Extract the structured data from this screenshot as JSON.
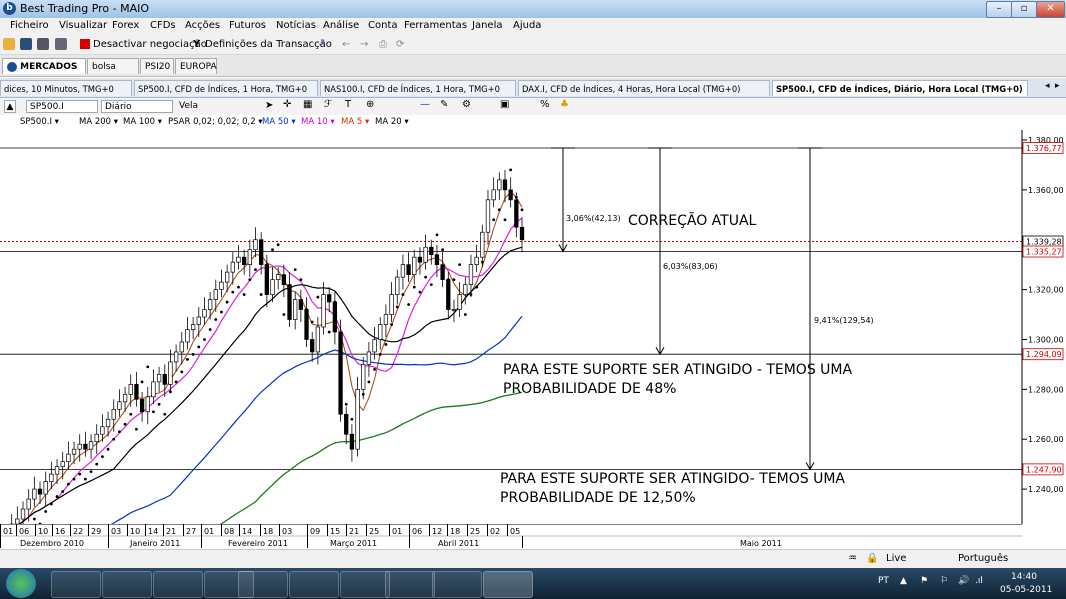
{
  "window": {
    "title": "Best Trading Pro - MAIO",
    "min": "–",
    "max": "▫",
    "close": "✕"
  },
  "menu": [
    "Ficheiro",
    "Visualizar",
    "Forex",
    "CFDs",
    "Acções",
    "Futuros",
    "Notícias",
    "Análise",
    "Conta",
    "Ferramentas",
    "Janela",
    "Ajuda"
  ],
  "toolbar": {
    "deactivate": "Desactivar negociação",
    "settings": "Definições da Transacção"
  },
  "workspace_tabs": [
    "MERCADOS",
    "bolsa usa",
    "PSI20",
    "EUROPA"
  ],
  "workspace_close": "×",
  "chart_tabs": [
    "dices, 10 Minutos, TMG+0",
    "SP500.I, CFD de Índices, 1 Hora, TMG+0",
    "NAS100.I, CFD de Índices, 1 Hora, TMG+0",
    "DAX.I, CFD de Índices, 4 Horas, Hora Local (TMG+0)",
    "SP500.I, CFD de Índices, Diário, Hora Local (TMG+0)"
  ],
  "chart_toolbar": {
    "symbol": "SP500.I",
    "period": "Diário",
    "style": "Vela"
  },
  "indicators": [
    "SP500.I ▾",
    "MA 200 ▾",
    "MA 100 ▾",
    "PSAR 0,02; 0,02; 0,2 ▾",
    "MA 50 ▾",
    "MA 10 ▾",
    "MA 5 ▾",
    "MA 20 ▾"
  ],
  "indicator_colors": [
    "#000000",
    "#000000",
    "#1a7a1a",
    "#000000",
    "#0033cc",
    "#cc00cc",
    "#cc3300",
    "#000000"
  ],
  "status": {
    "live": "Live",
    "language": "Português"
  },
  "tray": {
    "lang": "PT",
    "time": "14:40",
    "date": "05-05-2011"
  },
  "chart_data": {
    "type": "candlestick",
    "symbol": "SP500.I",
    "timeframe": "Diário",
    "ylim": [
      1226,
      1384
    ],
    "y_ticks": [
      1240,
      1260,
      1280,
      1300,
      1320,
      1340,
      1360,
      1380
    ],
    "y_tick_labels": [
      "1.240,00",
      "1.260,00",
      "1.280,00",
      "1.300,00",
      "1.320,00",
      "1.340,00",
      "1.360,00",
      "1.380,00"
    ],
    "x_day_labels": [
      "01",
      "06",
      "10",
      "16",
      "22",
      "29",
      "03",
      "10",
      "14",
      "21",
      "27",
      "01",
      "08",
      "14",
      "18",
      "03",
      "09",
      "15",
      "21",
      "25",
      "01",
      "06",
      "12",
      "18",
      "25",
      "02",
      "05"
    ],
    "x_month_labels": [
      "Dezembro 2010",
      "Janeiro 2011",
      "Fevereiro 2011",
      "Março 2011",
      "Abril 2011",
      "Maio 2011"
    ],
    "price_labels": [
      {
        "value": 1376.77,
        "label": "1.376,77",
        "color": "#cc0000"
      },
      {
        "value": 1339.28,
        "label": "1.339,28",
        "color": "#000000"
      },
      {
        "value": 1335.27,
        "label": "1.335,27",
        "color": "#cc0000"
      },
      {
        "value": 1294.09,
        "label": "1.294,09",
        "color": "#cc0000"
      },
      {
        "value": 1247.9,
        "label": "1.247,90",
        "color": "#cc0000"
      }
    ],
    "levels": [
      1376.77,
      1335.27,
      1294.09,
      1247.9
    ],
    "current_price": 1339.28,
    "measures": [
      {
        "label": "3,06%(42,13)",
        "from": 1376.77,
        "to": 1335.27
      },
      {
        "label": "6,03%(83,06)",
        "from": 1376.77,
        "to": 1294.09
      },
      {
        "label": "9,41%(129,54)",
        "from": 1376.77,
        "to": 1247.9
      }
    ],
    "annotations": [
      "CORREÇÃO ATUAL",
      "PARA ESTE SUPORTE SER ATINGIDO - TEMOS UMA",
      "PROBABILIDADE DE 48%",
      "PARA ESTE SUPORTE SER ATINGIDO- TEMOS UMA",
      "PROBABILIDADE DE 12,50%"
    ],
    "closes": [
      1222,
      1226,
      1228,
      1232,
      1236,
      1240,
      1238,
      1243,
      1246,
      1249,
      1251,
      1254,
      1256,
      1258,
      1256,
      1259,
      1262,
      1265,
      1268,
      1272,
      1275,
      1278,
      1282,
      1276,
      1271,
      1277,
      1283,
      1286,
      1282,
      1291,
      1295,
      1299,
      1304,
      1306,
      1309,
      1312,
      1316,
      1320,
      1323,
      1327,
      1331,
      1333,
      1330,
      1336,
      1340,
      1330,
      1318,
      1324,
      1326,
      1322,
      1308,
      1316,
      1312,
      1300,
      1295,
      1305,
      1318,
      1315,
      1303,
      1270,
      1262,
      1256,
      1280,
      1290,
      1295,
      1300,
      1306,
      1310,
      1318,
      1325,
      1330,
      1326,
      1333,
      1331,
      1337,
      1334,
      1330,
      1324,
      1312,
      1312,
      1318,
      1322,
      1330,
      1333,
      1343,
      1356,
      1360,
      1364,
      1360,
      1356,
      1345,
      1340
    ]
  }
}
